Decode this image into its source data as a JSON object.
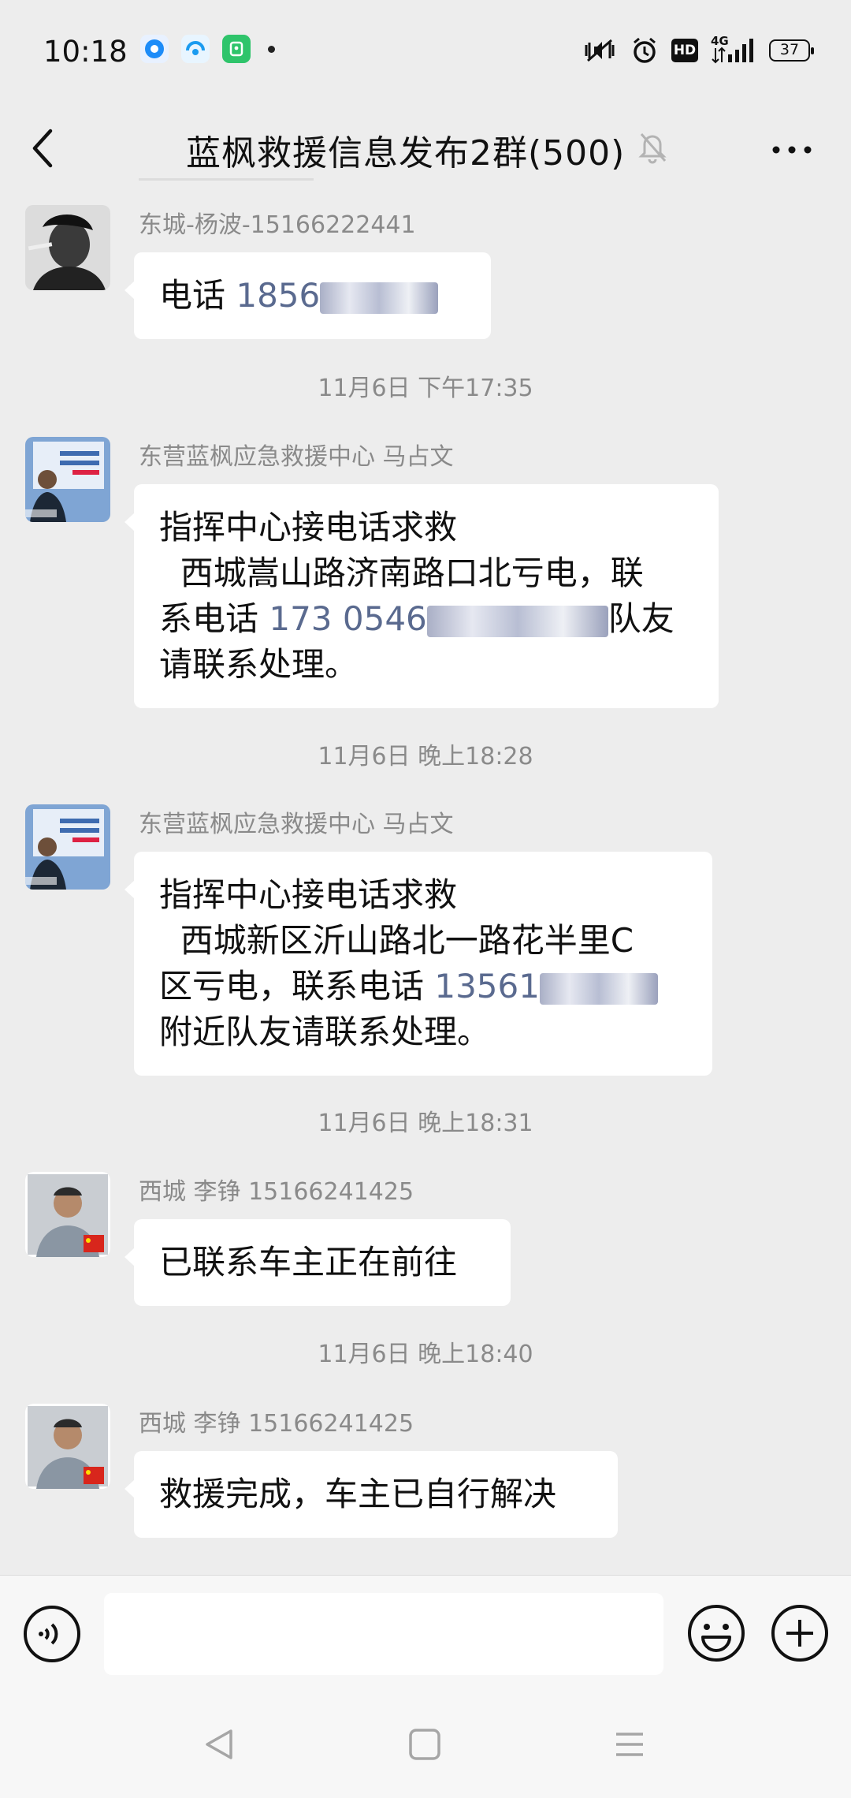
{
  "status_bar": {
    "time": "10:18",
    "battery": "37",
    "icons": [
      "notification-app-icon",
      "message-app-icon",
      "wechat-app-icon",
      "mute-vibrate-icon",
      "alarm-icon",
      "hd-icon",
      "signal-4g-icon",
      "battery-icon"
    ],
    "hd_label": "HD",
    "network_label": "4G"
  },
  "header": {
    "title": "蓝枫救援信息发布2群(500)",
    "icons": [
      "back-arrow-icon",
      "mute-bell-icon",
      "more-options-icon"
    ]
  },
  "messages": [
    {
      "sender": "东城-杨波-15166222441",
      "lines": [
        [
          "电话 ",
          "1856"
        ]
      ]
    },
    {
      "timestamp": "11月6日 下午17:35"
    },
    {
      "sender": "东营蓝枫应急救援中心 马占文",
      "lines": [
        [
          "指挥中心接电话求救"
        ],
        [
          "  西城嵩山路济南路口北亏电，联"
        ],
        [
          "系电话 ",
          "173 0546",
          "队友"
        ],
        [
          "请联系处理。"
        ]
      ]
    },
    {
      "timestamp": "11月6日 晚上18:28"
    },
    {
      "sender": "东营蓝枫应急救援中心 马占文",
      "lines": [
        [
          "指挥中心接电话求救"
        ],
        [
          "  西城新区沂山路北一路花半里C"
        ],
        [
          "区亏电，联系电话 ",
          "13561"
        ],
        [
          "附近队友请联系处理。"
        ]
      ]
    },
    {
      "timestamp": "11月6日 晚上18:31"
    },
    {
      "sender": "西城 李铮 15166241425",
      "lines": [
        [
          "已联系车主正在前往"
        ]
      ]
    },
    {
      "timestamp": "11月6日 晚上18:40"
    },
    {
      "sender": "西城 李铮 15166241425",
      "lines": [
        [
          "救援完成，车主已自行解决"
        ]
      ]
    }
  ],
  "input": {
    "value": "",
    "placeholder": ""
  },
  "colors": {
    "background": "#ededed",
    "bubble": "#ffffff",
    "link_phone": "#5a6a8f",
    "meta_text": "#8a8a8a"
  }
}
